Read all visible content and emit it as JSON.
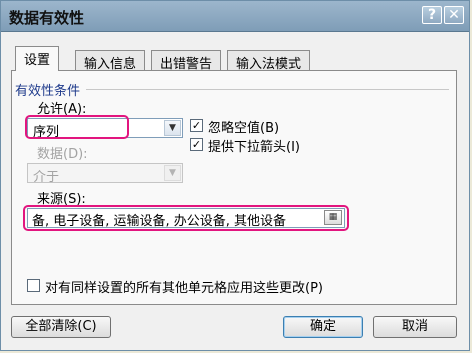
{
  "window": {
    "title": "数据有效性"
  },
  "titlebar_buttons": {
    "help": "?",
    "close": "✕"
  },
  "tabs": [
    {
      "label": "设置",
      "active": true
    },
    {
      "label": "输入信息",
      "active": false
    },
    {
      "label": "出错警告",
      "active": false
    },
    {
      "label": "输入法模式",
      "active": false
    }
  ],
  "settings": {
    "group_title": "有效性条件",
    "allow_label": "允许(A):",
    "allow_value": "序列",
    "ignore_blank_label": "忽略空值(B)",
    "ignore_blank_checked": true,
    "dropdown_label": "提供下拉箭头(I)",
    "dropdown_checked": true,
    "data_label": "数据(D):",
    "data_value": "介于",
    "source_label": "来源(S):",
    "source_value": "备, 电子设备, 运输设备, 办公设备, 其他设备",
    "apply_all_label": "对有同样设置的所有其他单元格应用这些更改(P)",
    "apply_all_checked": false
  },
  "buttons": {
    "clear_all": "全部清除(C)",
    "ok": "确定",
    "cancel": "取消"
  },
  "colors": {
    "highlight": "#e2157f",
    "titlebar": "#8ba7c0",
    "group_title": "#1f3b8c"
  },
  "icons": {
    "ref_select": "range-select-icon",
    "check": "check-icon",
    "dropdown": "chevron-down-icon"
  }
}
